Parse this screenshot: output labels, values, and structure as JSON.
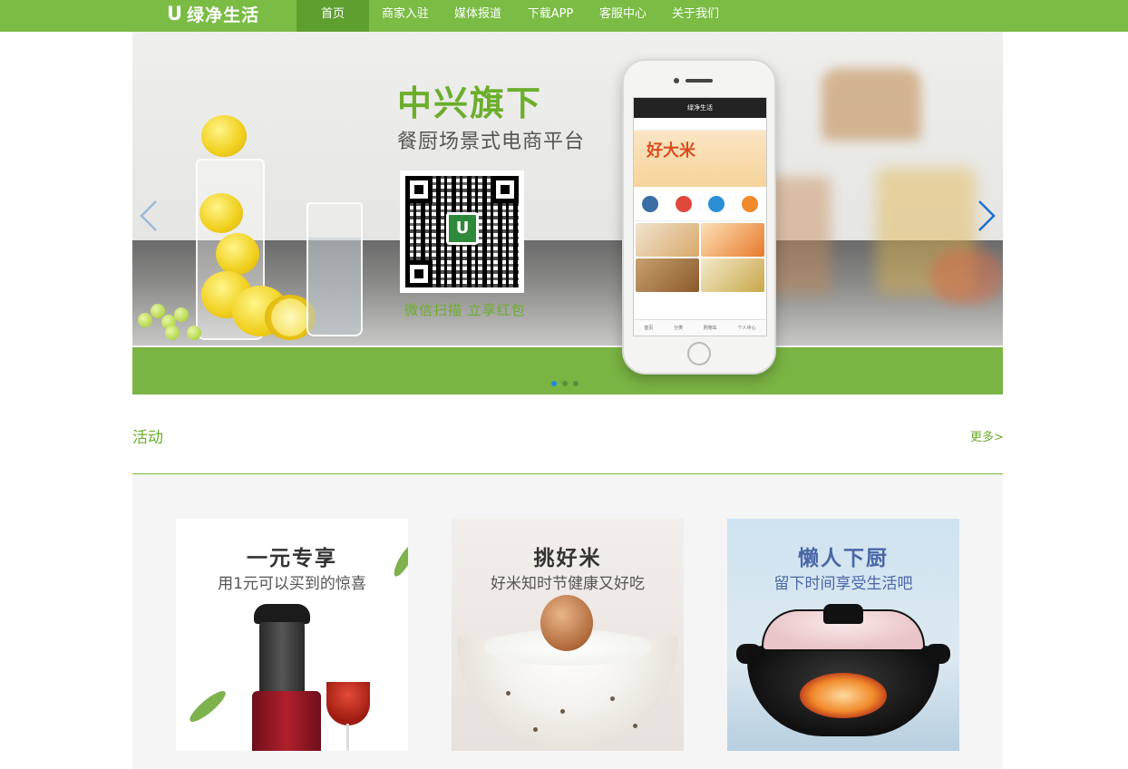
{
  "brand": {
    "logo_mark": "U",
    "name": "绿净生活"
  },
  "nav": {
    "items": [
      {
        "label": "首页",
        "active": true
      },
      {
        "label": "商家入驻",
        "active": false
      },
      {
        "label": "媒体报道",
        "active": false
      },
      {
        "label": "下载APP",
        "active": false
      },
      {
        "label": "客服中心",
        "active": false
      },
      {
        "label": "关于我们",
        "active": false
      }
    ]
  },
  "banner": {
    "title": "中兴旗下",
    "subtitle": "餐厨场景式电商平台",
    "qr_logo_mark": "U",
    "qr_caption": "微信扫描 立享红包",
    "phone_app_title": "绿净生活",
    "phone_hero_text": "好大米",
    "phone_tabs": [
      "首页",
      "分类",
      "购物车",
      "个人中心"
    ],
    "slides": 3,
    "active_slide": 0,
    "prev_icon": "chevron-left-icon",
    "next_icon": "chevron-right-icon"
  },
  "activity": {
    "title": "活动",
    "more": "更多>",
    "cards": [
      {
        "title": "一元专享",
        "subtitle": "用1元可以买到的惊喜"
      },
      {
        "title": "挑好米",
        "subtitle": "好米知时节健康又好吃"
      },
      {
        "title": "懒人下厨",
        "subtitle": "留下时间享受生活吧"
      }
    ]
  },
  "colors": {
    "brand_green": "#7abc44",
    "active_nav": "#5ea02f",
    "accent_text_green": "#6cae2c",
    "dot_active": "#1e88e5"
  }
}
